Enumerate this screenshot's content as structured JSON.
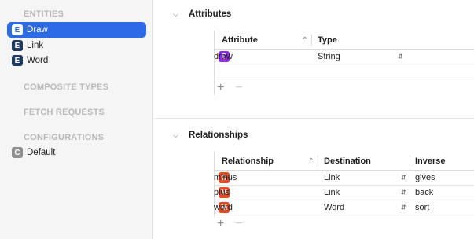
{
  "sidebar": {
    "entities_title": "ENTITIES",
    "entities": [
      {
        "letter": "E",
        "label": "Draw",
        "selected": true
      },
      {
        "letter": "E",
        "label": "Link",
        "selected": false
      },
      {
        "letter": "E",
        "label": "Word",
        "selected": false
      }
    ],
    "composite_title": "COMPOSITE TYPES",
    "fetch_title": "FETCH REQUESTS",
    "config_title": "CONFIGURATIONS",
    "configurations": [
      {
        "letter": "C",
        "label": "Default"
      }
    ]
  },
  "attributes": {
    "title": "Attributes",
    "columns": {
      "attribute": "Attribute",
      "type": "Type"
    },
    "rows": [
      {
        "badge": "S",
        "name": "draw",
        "type": "String"
      }
    ]
  },
  "relationships": {
    "title": "Relationships",
    "columns": {
      "relationship": "Relationship",
      "destination": "Destination",
      "inverse": "Inverse"
    },
    "rows": [
      {
        "badge": "O",
        "name": "minus",
        "destination": "Link",
        "inverse": "gives"
      },
      {
        "badge": "M",
        "name": "plus",
        "destination": "Link",
        "inverse": "back"
      },
      {
        "badge": "M",
        "name": "word",
        "destination": "Word",
        "inverse": "sort"
      }
    ]
  },
  "icons": {
    "add": "plus-icon",
    "remove": "minus-icon",
    "collapse": "chevron-down-icon",
    "sort": "chevron-up-icon",
    "popup": "up-down-arrows-icon"
  },
  "colors": {
    "selection": "#2d6be6",
    "entity_badge": "#1e3a5f",
    "attribute_badge": "#8a2be2",
    "relationship_badge": "#e24b26",
    "configuration_badge": "#8e8e8e"
  }
}
